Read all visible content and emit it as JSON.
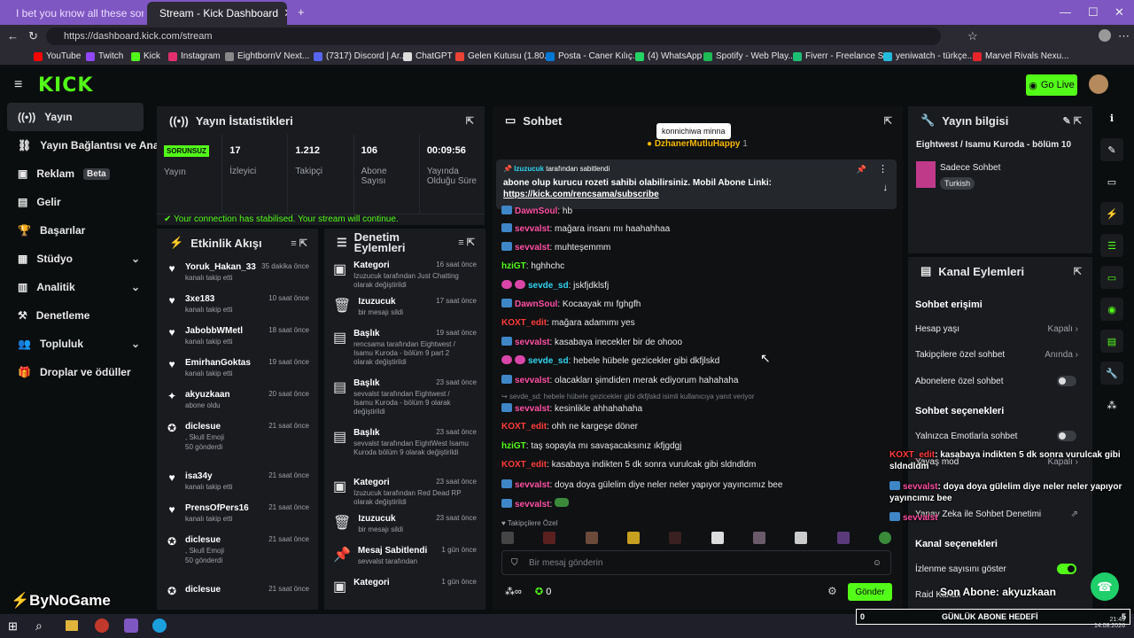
{
  "browser": {
    "tabs": [
      {
        "title": "I bet you know all these song"
      },
      {
        "title": "Stream - Kick Dashboard"
      }
    ],
    "url": "https://dashboard.kick.com/stream",
    "bookmarks": [
      "YouTube",
      "Twitch",
      "Kick",
      "Instagram",
      "EightbornV Next...",
      "(7317) Discord | Ar...",
      "ChatGPT",
      "Gelen Kutusu (1.80...",
      "Posta - Caner Kılıç...",
      "(4) WhatsApp",
      "Spotify - Web Play...",
      "Fiverr - Freelance S...",
      "yeniwatch - türkçe...",
      "Marvel Rivals Nexu..."
    ]
  },
  "header": {
    "logo": "KICK",
    "go_live": "Go Live"
  },
  "sidebar": {
    "items": [
      {
        "label": "Yayın"
      },
      {
        "label": "Yayın Bağlantısı ve Anahtarı"
      },
      {
        "label": "Reklam",
        "badge": "Beta"
      },
      {
        "label": "Gelir"
      },
      {
        "label": "Başarılar"
      },
      {
        "label": "Stüdyo"
      },
      {
        "label": "Analitik"
      },
      {
        "label": "Denetleme"
      },
      {
        "label": "Topluluk"
      },
      {
        "label": "Droplar ve ödüller"
      }
    ]
  },
  "stats": {
    "title": "Yayın İstatistikleri",
    "status": "SORUNSUZ",
    "status_label": "Yayın",
    "viewers": {
      "value": "17",
      "label": "İzleyici"
    },
    "followers": {
      "value": "1.212",
      "label": "Takipçi"
    },
    "subs": {
      "value": "106",
      "label": "Abone Sayısı"
    },
    "uptime": {
      "value": "00:09:56",
      "label": "Yayında Olduğu Süre"
    },
    "connection": "Your connection has stabilised. Your stream will continue."
  },
  "activity": {
    "title": "Etkinlik Akışı",
    "rows": [
      {
        "name": "Yoruk_Hakan_33",
        "sub": "kanalı takip etti",
        "time": "35 dakika önce"
      },
      {
        "name": "3xe183",
        "sub": "kanalı takip etti",
        "time": "10 saat önce"
      },
      {
        "name": "JabobbWMetl",
        "sub": "kanalı takip etti",
        "time": "18 saat önce"
      },
      {
        "name": "EmirhanGoktas",
        "sub": "kanalı takip etti",
        "time": "19 saat önce"
      },
      {
        "name": "akyuzkaan",
        "sub": "abone oldu",
        "time": "20 saat önce"
      },
      {
        "name": "diclesue",
        "sub": ", Skull Emoji",
        "extra": "50 gönderdi",
        "time": "21 saat önce"
      },
      {
        "name": "isa34y",
        "sub": "kanalı takip etti",
        "time": "21 saat önce"
      },
      {
        "name": "PrensOfPers16",
        "sub": "kanalı takip etti",
        "time": "21 saat önce"
      },
      {
        "name": "diclesue",
        "sub": ", Skull Emoji",
        "extra": "50 gönderdi",
        "time": "21 saat önce"
      },
      {
        "name": "diclesue",
        "sub": "",
        "time": "21 saat önce"
      }
    ]
  },
  "moderation": {
    "title": "Denetim Eylemleri",
    "rows": [
      {
        "name": "Kategori",
        "sub": "Izuzucuk tarafından Just Chatting olarak değiştirildi",
        "time": "16 saat önce"
      },
      {
        "name": "Izuzucuk",
        "sub": "bir mesajı sildi",
        "time": "17 saat önce"
      },
      {
        "name": "Başlık",
        "sub": "rencsama tarafından Eightwest / Isamu Kuroda - bölüm 9 part 2 olarak değiştirildi",
        "time": "19 saat önce"
      },
      {
        "name": "Başlık",
        "sub": "sevvalst tarafından Eightwest / Isamu Kuroda - bölüm 9 olarak değiştirildi",
        "time": "23 saat önce"
      },
      {
        "name": "Başlık",
        "sub": "sevvalst tarafından EightWest Isamu Kuroda bölüm 9 olarak değiştirildi",
        "time": "23 saat önce"
      },
      {
        "name": "Kategori",
        "sub": "Izuzucuk tarafından Red Dead RP olarak değiştirildi",
        "time": "23 saat önce"
      },
      {
        "name": "Izuzucuk",
        "sub": "bir mesajı sildi",
        "time": "23 saat önce"
      },
      {
        "name": "Mesaj Sabitlendi",
        "sub": "sevvalst tarafından",
        "time": "1 gün önce"
      },
      {
        "name": "Kategori",
        "sub": "",
        "time": "1 gün önce"
      }
    ]
  },
  "chat": {
    "title": "Sohbet",
    "tooltip": "konnichiwa minna",
    "top_user": "DzhanerMutluHappy",
    "top_count": "1",
    "pinned": {
      "by": "Izuzucuk",
      "by_suffix": "tarafından sabitlendi",
      "text": "abone olup kurucu rozeti sahibi olabilirsiniz. Mobil Abone Linki:",
      "link": "https://kick.com/rencsama/subscribe"
    },
    "messages": [
      {
        "user": "DawnSoul",
        "text": "hb"
      },
      {
        "user": "sevvalst",
        "text": "mağara insanı mı haahahhaa"
      },
      {
        "user": "sevvalst",
        "text": "muhteşemmm"
      },
      {
        "user": "hziGT",
        "text": "hghhchc"
      },
      {
        "user": "sevde_sd",
        "text": "jskfjdklsfj"
      },
      {
        "user": "DawnSoul",
        "text": "Kocaayak mı fghgfh"
      },
      {
        "user": "KOXT_edit",
        "text": "mağara adamımı yes"
      },
      {
        "user": "sevvalst",
        "text": "kasabaya inecekler bir de ohooo"
      },
      {
        "user": "sevde_sd",
        "text": "hebele hübele gezicekler gibi dkfjlskd"
      },
      {
        "user": "sevvalst",
        "text": "olacakları şimdiden merak ediyorum hahahaha"
      },
      {
        "reply": "sevde_sd: hebele hübele gezicekler gibi dkfjlskd isimli kullanıcıya yanıt veriyor"
      },
      {
        "user": "sevvalst",
        "text": "kesinlikle ahhahahaha"
      },
      {
        "user": "KOXT_edit",
        "text": "ohh ne kargeşe döner"
      },
      {
        "user": "hziGT",
        "text": "taş sopayla mı savaşacaksınız ıkfjgdgj"
      },
      {
        "user": "KOXT_edit",
        "text": "kasabaya indikten 5 dk sonra vurulcak gibi sldndldm"
      },
      {
        "user": "sevvalst",
        "text": "doya doya gülelim diye neler neler yapıyor yayıncımız bee"
      },
      {
        "user": "sevvalst",
        "text": ""
      }
    ],
    "followers_only": "Takipçilere Özel",
    "placeholder": "Bir mesaj gönderin",
    "points": "0",
    "send": "Gönder"
  },
  "stream_info": {
    "title": "Yayın bilgisi",
    "stream_title": "Eightwest / Isamu Kuroda - bölüm 10",
    "category": "Sadece Sohbet",
    "language": "Turkish"
  },
  "channel_actions": {
    "title": "Kanal Eylemleri",
    "chat_access": "Sohbet erişimi",
    "account_age": {
      "label": "Hesap yaşı",
      "value": "Kapalı"
    },
    "followers_only": {
      "label": "Takipçilere özel sohbet",
      "value": "Anında"
    },
    "subs_only": {
      "label": "Abonelere özel sohbet"
    },
    "chat_options": "Sohbet seçenekleri",
    "emote_only": {
      "label": "Yalnızca Emotlarla sohbet"
    },
    "slow_mode": {
      "label": "Yavaş mod",
      "value": "Kapalı"
    },
    "ai_mod": {
      "label": "Yapay Zeka ile Sohbet Denetimi"
    },
    "channel_options": "Kanal seçenekleri",
    "show_viewers": {
      "label": "İzlenme sayısını göster"
    },
    "raid": {
      "label": "Raid Kanalı"
    }
  },
  "overlay": {
    "brand": "ByNoGame",
    "line1_user": "KOXT_edit",
    "line1_text": ": kasabaya indikten 5 dk sonra vurulcak gibi sldndldm",
    "line2_user": "sevvalst",
    "line2_text": ": doya doya gülelim diye neler neler yapıyor yayıncımız bee",
    "line3_user": "sevvalst",
    "last_sub": "Son Abone: akyuzkaan",
    "goal_left": "0",
    "goal_label": "GÜNLÜK ABONE HEDEFİ",
    "goal_right": "5",
    "clock_time": "21:45",
    "clock_date": "14.08.2026"
  }
}
